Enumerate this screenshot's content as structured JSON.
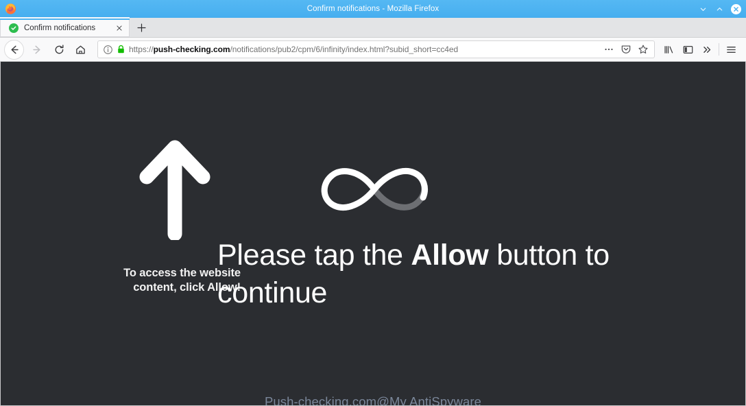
{
  "window": {
    "title": "Confirm notifications - Mozilla Firefox",
    "logo_icon": "firefox-logo",
    "controls": {
      "minimize_icon": "chevron-down-icon",
      "maximize_icon": "chevron-up-icon",
      "close_icon": "close-icon"
    }
  },
  "tabstrip": {
    "tabs": [
      {
        "title": "Confirm notifications",
        "favicon_icon": "green-check-favicon",
        "close_icon": "close-icon",
        "active": true
      }
    ],
    "new_tab_icon": "plus-icon",
    "new_tab_label": "+"
  },
  "toolbar": {
    "back_icon": "arrow-left-icon",
    "forward_icon": "arrow-right-icon",
    "reload_icon": "reload-icon",
    "home_icon": "home-icon",
    "library_icon": "library-icon",
    "sidebar_icon": "sidebar-icon",
    "overflow_icon": "chevron-double-right-icon",
    "menu_icon": "hamburger-menu-icon"
  },
  "urlbar": {
    "info_icon": "info-circle-icon",
    "lock_icon": "padlock-icon",
    "scheme": "https://",
    "domain": "push-checking.com",
    "path": "/notifications/pub2/cpm/6/infinity/index.html?subid_short=cc4ed",
    "full_url": "https://push-checking.com/notifications/pub2/cpm/6/infinity/index.html?subid_short=cc4ed",
    "page_actions_icon": "ellipsis-icon",
    "reader_icon": "pocket-icon",
    "bookmark_icon": "star-icon"
  },
  "page": {
    "background_color": "#2b2d31",
    "arrow_icon": "arrow-up-icon",
    "spinner_icon": "infinity-spinner-icon",
    "small_message_line1": "To access the website",
    "small_message_line2": "content, click Allow!",
    "headline_prefix": "Please tap the ",
    "headline_emphasis": "Allow",
    "headline_suffix": " button to continue",
    "watermark": "Push-checking.com@My AntiSpyware",
    "watermark_color": "#7a8699"
  }
}
